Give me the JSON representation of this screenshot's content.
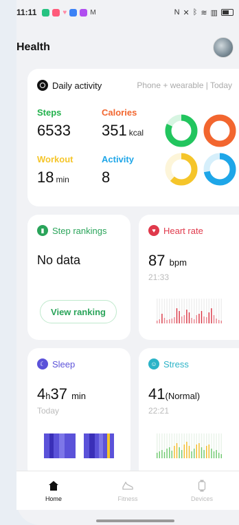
{
  "status_bar": {
    "time": "11:11"
  },
  "header": {
    "title": "Health"
  },
  "daily": {
    "title": "Daily activity",
    "source": "Phone + wearable | Today",
    "steps": {
      "label": "Steps",
      "value": "6533"
    },
    "calories": {
      "label": "Calories",
      "value": "351",
      "unit": "kcal"
    },
    "workout": {
      "label": "Workout",
      "value": "18",
      "unit": "min"
    },
    "activity": {
      "label": "Activity",
      "value": "8"
    },
    "rings": [
      {
        "name": "steps",
        "color": "#22c55e",
        "progress": 0.82
      },
      {
        "name": "calories",
        "color": "#f2662f",
        "progress": 1.0
      },
      {
        "name": "workout",
        "color": "#f5c52a",
        "progress": 0.62
      },
      {
        "name": "activity",
        "color": "#1ea6e8",
        "progress": 0.72
      }
    ]
  },
  "step_rankings": {
    "title": "Step rankings",
    "value": "No data",
    "button": "View ranking",
    "color": "#2aa45a"
  },
  "heart_rate": {
    "title": "Heart rate",
    "value": "87",
    "unit": "bpm",
    "time": "21:33",
    "color": "#e0394b"
  },
  "sleep": {
    "title": "Sleep",
    "hours": "4",
    "h_unit": "h",
    "minutes": "37",
    "m_unit": "min",
    "day": "Today",
    "color": "#5b52d9"
  },
  "stress": {
    "title": "Stress",
    "value": "41",
    "state": "(Normal)",
    "time": "22:21",
    "color": "#2bb3c7"
  },
  "nav": {
    "home": "Home",
    "fitness": "Fitness",
    "devices": "Devices"
  }
}
